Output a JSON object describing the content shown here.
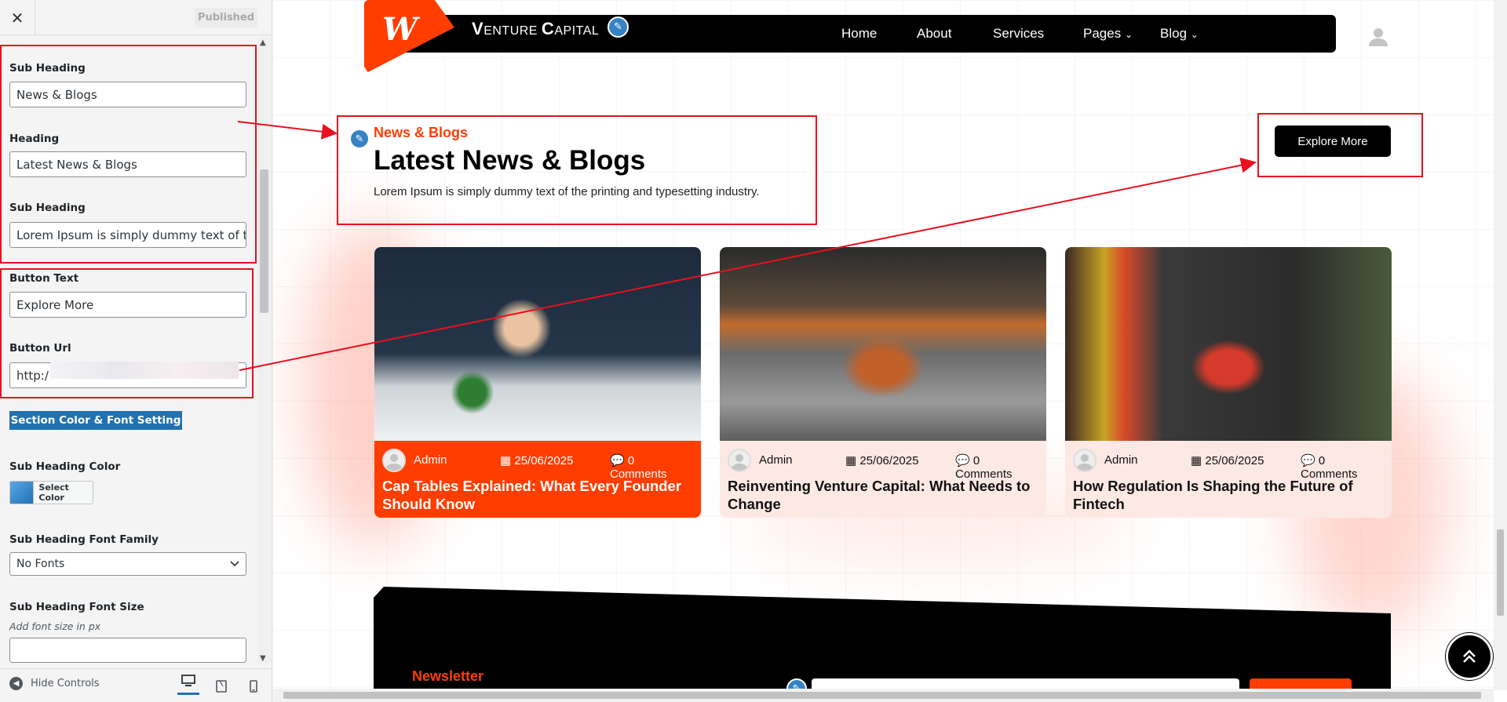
{
  "sidebar": {
    "close_icon": "close-icon",
    "publish_label": "Published",
    "fields": {
      "sub_heading_label": "Sub Heading",
      "sub_heading_value": "News & Blogs",
      "heading_label": "Heading",
      "heading_value": "Latest News & Blogs",
      "description_label": "Sub Heading",
      "description_value": "Lorem Ipsum is simply dummy text of the printing and typesetting industry.",
      "button_text_label": "Button Text",
      "button_text_value": "Explore More",
      "button_url_label": "Button Url",
      "button_url_value": "http:/"
    },
    "section_button": "Section Color & Font Setting",
    "sub_heading_color_label": "Sub Heading Color",
    "select_color_label": "Select Color",
    "font_family_label": "Sub Heading Font Family",
    "font_family_value": "No Fonts",
    "font_size_label": "Sub Heading Font Size",
    "font_size_help": "Add font size in px",
    "font_size_value": "",
    "hide_controls": "Hide Controls",
    "devices": [
      "desktop-icon",
      "tablet-icon",
      "mobile-icon"
    ]
  },
  "preview": {
    "brand": "VENTURE CAPITAL",
    "nav": [
      "Home",
      "About",
      "Services",
      "Pages",
      "Blog"
    ],
    "section": {
      "sub_heading": "News & Blogs",
      "heading": "Latest News & Blogs",
      "description": "Lorem Ipsum is simply dummy text of the printing and typesetting industry.",
      "button": "Explore More"
    },
    "cards": [
      {
        "author": "Admin",
        "date": "25/06/2025",
        "comments": "0 Comments",
        "title": "Cap Tables Explained: What Every Founder Should Know",
        "highlighted": true
      },
      {
        "author": "Admin",
        "date": "25/06/2025",
        "comments": "0 Comments",
        "title": "Reinventing Venture Capital: What Needs to Change",
        "highlighted": false
      },
      {
        "author": "Admin",
        "date": "25/06/2025",
        "comments": "0 Comments",
        "title": "How Regulation Is Shaping the Future of Fintech",
        "highlighted": false
      }
    ],
    "newsletter_label": "Newsletter"
  },
  "colors": {
    "accent": "#ff3d00",
    "wp_blue": "#2271b1",
    "annotation": "#e8101f",
    "card_tint": "#fde9e4"
  }
}
